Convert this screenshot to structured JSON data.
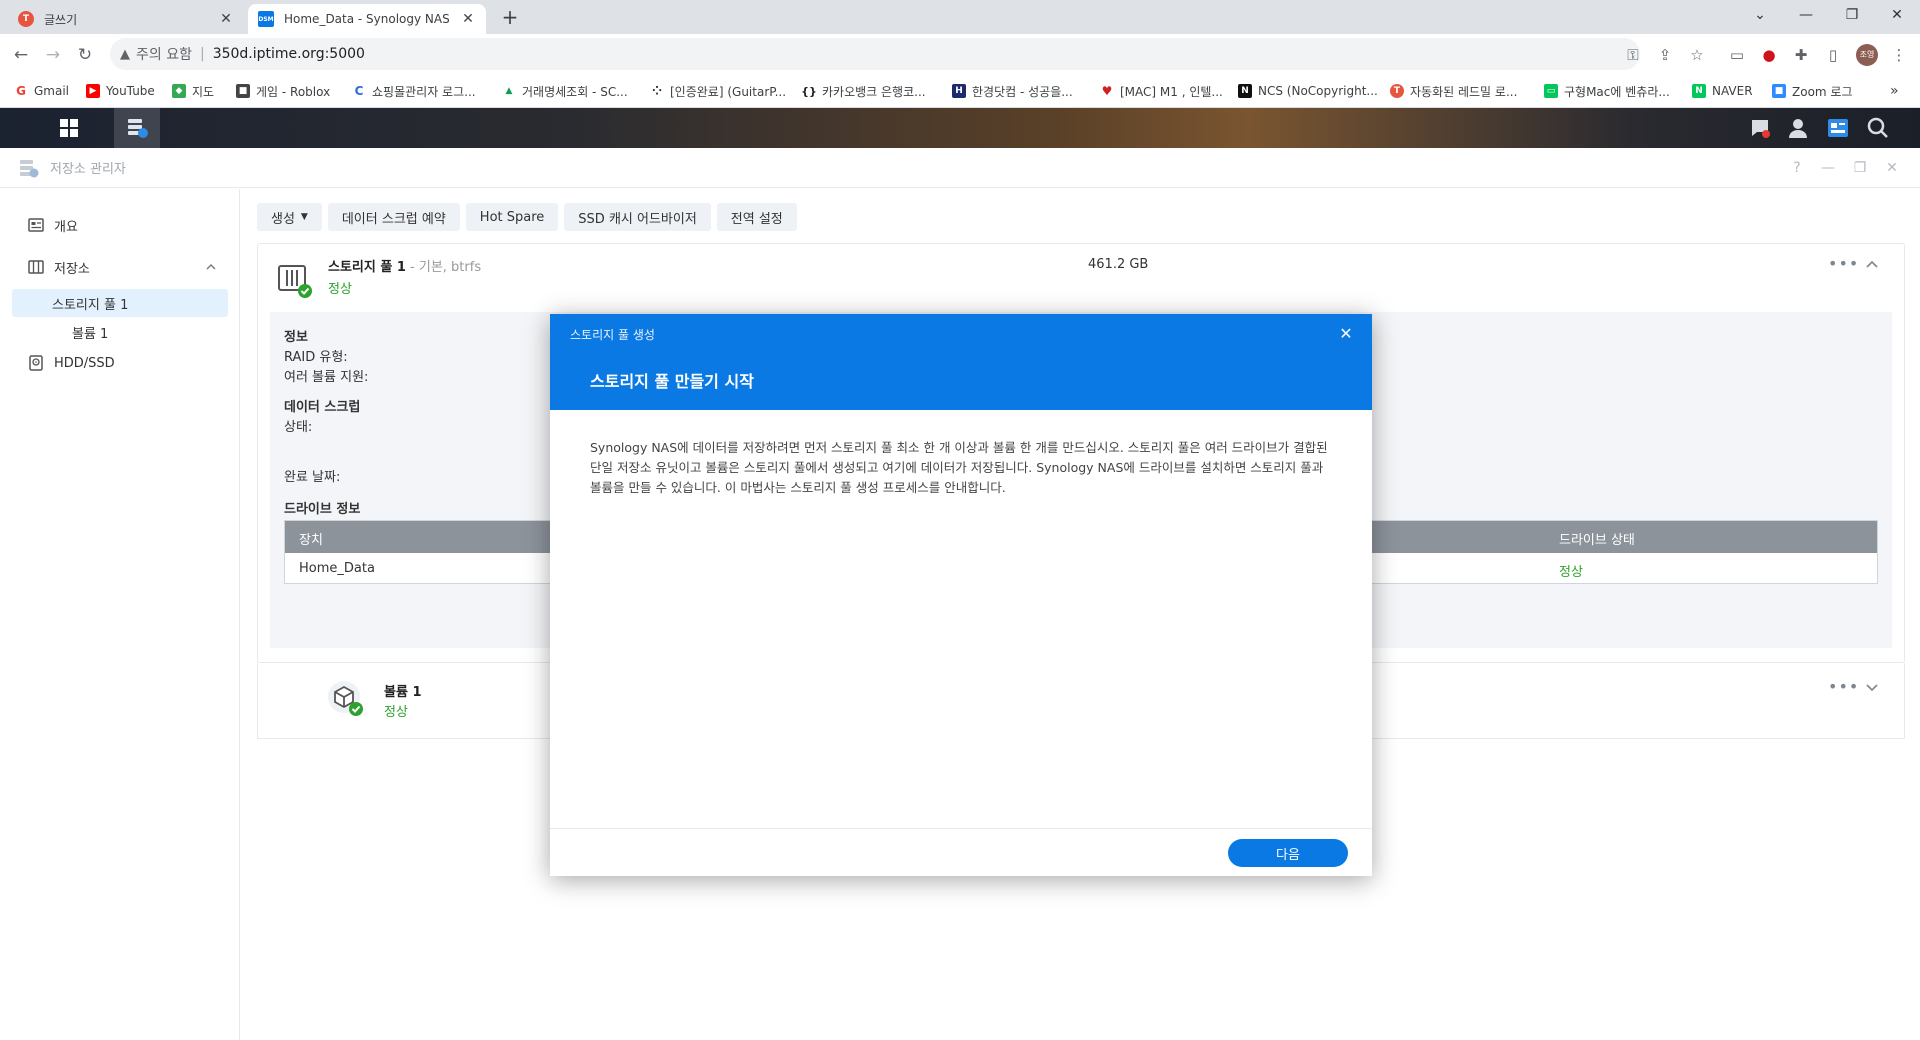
{
  "browser": {
    "tabs": [
      {
        "title": "글쓰기",
        "favicon_color": "#e8553e",
        "favicon_text": "T",
        "active": false
      },
      {
        "title": "Home_Data - Synology NAS",
        "favicon_color": "#0a79e3",
        "favicon_text": "DSM",
        "active": true
      }
    ],
    "address": {
      "security_label": "주의 요함",
      "url": "350d.iptime.org:5000"
    },
    "bookmarks": [
      {
        "label": "Gmail",
        "color": "#ea4335",
        "glyph": "G"
      },
      {
        "label": "YouTube",
        "color": "#ff0000",
        "glyph": "▶"
      },
      {
        "label": "지도",
        "color": "#34a853",
        "glyph": "◆"
      },
      {
        "label": "게임 - Roblox",
        "color": "#444444",
        "glyph": "■"
      },
      {
        "label": "쇼핑몰관리자 로그...",
        "color": "#2a6dd9",
        "glyph": "C"
      },
      {
        "label": "거래명세조회 - SC...",
        "color": "#0f9d58",
        "glyph": "▲"
      },
      {
        "label": "[인증완료] (GuitarP...",
        "color": "#222222",
        "glyph": "⁘"
      },
      {
        "label": "카카오뱅크 은행코...",
        "color": "#222222",
        "glyph": "{}"
      },
      {
        "label": "한경닷컴 - 성공을...",
        "color": "#1d2a6b",
        "glyph": "H"
      },
      {
        "label": "[MAC] M1 , 인텔...",
        "color": "#d02020",
        "glyph": "♥"
      },
      {
        "label": "NCS (NoCopyright...",
        "color": "#111111",
        "glyph": "N"
      },
      {
        "label": "자동화된 레드밀 로...",
        "color": "#e8553e",
        "glyph": "T"
      },
      {
        "label": "구형Mac에 벤츄라...",
        "color": "#03c75a",
        "glyph": "▭"
      },
      {
        "label": "NAVER",
        "color": "#03c75a",
        "glyph": "N"
      },
      {
        "label": "Zoom 로그",
        "color": "#2d8cff",
        "glyph": "■"
      }
    ],
    "profile_initials": "조영"
  },
  "app": {
    "title": "저장소 관리자",
    "sidebar": {
      "overview": "개요",
      "storage": "저장소",
      "pool": "스토리지 풀 1",
      "volume": "볼륨 1",
      "hdd": "HDD/SSD"
    },
    "toolbar": {
      "create": "생성",
      "scrub": "데이터 스크럽 예약",
      "hot_spare": "Hot Spare",
      "ssd_advisor": "SSD 캐시 어드바이저",
      "global": "전역 설정"
    },
    "pool": {
      "name": "스토리지 풀 1",
      "meta": " - 기본, btrfs",
      "status": "정상",
      "size": "461.2 GB",
      "info_heading": "정보",
      "raid_label": "RAID 유형:",
      "multi_volume_label": "여러 볼륨 지원:",
      "scrub_heading": "데이터 스크럽",
      "state_label": "상태:",
      "completed_label": "완료 날짜:",
      "drive_heading": "드라이브 정보",
      "table": {
        "col_device": "장치",
        "col_status": "드라이브 상태",
        "row_device": "Home_Data",
        "row_status": "정상"
      }
    },
    "volume": {
      "name": "볼륨 1",
      "status": "정상"
    }
  },
  "modal": {
    "subtitle": "스토리지 풀 생성",
    "title": "스토리지 풀 만들기 시작",
    "body": "Synology NAS에 데이터를 저장하려면 먼저 스토리지 풀 최소 한 개 이상과 볼륨 한 개를 만드십시오. 스토리지 풀은 여러 드라이브가 결합된 단일 저장소 유닛이고 볼륨은 스토리지 풀에서 생성되고 여기에 데이터가 저장됩니다. Synology NAS에 드라이브를 설치하면 스토리지 풀과 볼륨을 만들 수 있습니다. 이 마법사는 스토리지 풀 생성 프로세스를 안내합니다.",
    "next": "다음"
  },
  "colors": {
    "accent": "#0a79e3",
    "ok": "#2ea22e"
  }
}
